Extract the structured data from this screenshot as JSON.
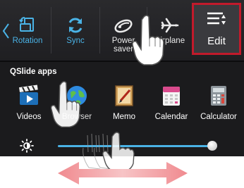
{
  "quick_settings": {
    "items": [
      {
        "label": "Rotation",
        "icon": "rotation-icon"
      },
      {
        "label": "Sync",
        "icon": "sync-icon"
      },
      {
        "label": "Power saver",
        "label_line1": "Power",
        "label_line2": "saver",
        "icon": "power-saver-icon"
      },
      {
        "label": "Airplane",
        "icon": "airplane-icon"
      }
    ],
    "edit": {
      "label": "Edit",
      "icon": "edit-sort-icon",
      "highlight_color": "#c21a2b"
    }
  },
  "qslide": {
    "title": "QSlide apps",
    "apps": [
      {
        "label": "Videos",
        "icon": "videos-icon"
      },
      {
        "label": "Browser",
        "icon": "browser-icon"
      },
      {
        "label": "Memo",
        "icon": "memo-icon"
      },
      {
        "label": "Calendar",
        "icon": "calendar-icon"
      },
      {
        "label": "Calculator",
        "icon": "calculator-icon"
      }
    ]
  },
  "brightness": {
    "icon": "brightness-icon",
    "level_percent": 97
  },
  "colors": {
    "accent": "#4ab3e6",
    "background": "#1b1b1d",
    "arrow": "#f08a8f"
  }
}
